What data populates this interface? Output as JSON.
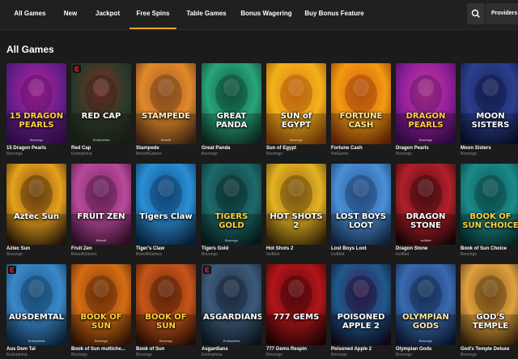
{
  "nav": {
    "tabs": [
      {
        "label": "All Games"
      },
      {
        "label": "New"
      },
      {
        "label": "Jackpot"
      },
      {
        "label": "Free Spins",
        "active": true
      },
      {
        "label": "Table Games"
      },
      {
        "label": "Bonus Wagering"
      },
      {
        "label": "Buy Bonus Feature"
      }
    ],
    "providers_label": "Providers",
    "search_icon": "search-icon",
    "accent_color": "#f5a31a"
  },
  "section_title": "All Games",
  "games": [
    {
      "name": "15 Dragon Pearls",
      "provider": "Booongo",
      "art_title": "15 DRAGON PEARLS",
      "art_provider": "Booongo",
      "colors": [
        "#6a1f8c",
        "#c4209a",
        "#3b0f5a"
      ],
      "title_color": "#ffd23a",
      "badge": false
    },
    {
      "name": "Red Cap",
      "provider": "Endorphina",
      "art_title": "RED CAP",
      "art_provider": "Endorphina",
      "colors": [
        "#2e3b2a",
        "#8c2b22",
        "#1d2618"
      ],
      "title_color": "#ffffff",
      "badge": true
    },
    {
      "name": "Stampede",
      "provider": "BetsoftGames",
      "art_title": "STAMPEDE",
      "art_provider": "Betsoft",
      "colors": [
        "#e08a2c",
        "#a85a1e",
        "#4a2a14"
      ],
      "title_color": "#fff1c2",
      "badge": false
    },
    {
      "name": "Great Panda",
      "provider": "Booongo",
      "art_title": "GREAT PANDA",
      "art_provider": "",
      "colors": [
        "#2aa57a",
        "#0e5a44",
        "#0b2f25"
      ],
      "title_color": "#ffffff",
      "badge": false
    },
    {
      "name": "Sun of Egypt",
      "provider": "Booongo",
      "art_title": "SUN of EGYPT",
      "art_provider": "Booongo",
      "colors": [
        "#f2b21c",
        "#e07b11",
        "#8a3d07"
      ],
      "title_color": "#ffffff",
      "badge": false
    },
    {
      "name": "Fortune Cash",
      "provider": "NetGame",
      "art_title": "FORTUNE CASH",
      "art_provider": "",
      "colors": [
        "#f39a12",
        "#d4600e",
        "#7a2b06"
      ],
      "title_color": "#ffe7a0",
      "badge": false
    },
    {
      "name": "Dragon Pearls",
      "provider": "Booongo",
      "art_title": "DRAGON PEARLS",
      "art_provider": "Booongo",
      "colors": [
        "#8e1f9a",
        "#d13a9c",
        "#3a0c4f"
      ],
      "title_color": "#ffd23a",
      "badge": false
    },
    {
      "name": "Moon Sisters",
      "provider": "Booongo",
      "art_title": "MOON SISTERS",
      "art_provider": "",
      "colors": [
        "#2b3f8c",
        "#1a2460",
        "#0a0f30"
      ],
      "title_color": "#ffffff",
      "badge": false
    },
    {
      "name": "Aztec Sun",
      "provider": "Booongo",
      "art_title": "Aztec Sun",
      "art_provider": "",
      "colors": [
        "#e6a11e",
        "#8a4f0c",
        "#2a1b0a"
      ],
      "title_color": "#ffffff",
      "badge": false
    },
    {
      "name": "Fruit Zen",
      "provider": "BetsoftGames",
      "art_title": "FRUIT ZEN",
      "art_provider": "Betsoft",
      "colors": [
        "#b84a9a",
        "#7a2a6a",
        "#3a1030"
      ],
      "title_color": "#ffffff",
      "badge": false
    },
    {
      "name": "Tiger's Claw",
      "provider": "BetsoftGames",
      "art_title": "Tigers Claw",
      "art_provider": "",
      "colors": [
        "#2b8fd4",
        "#12508c",
        "#0a2748"
      ],
      "title_color": "#ffffff",
      "badge": false
    },
    {
      "name": "Tigers Gold",
      "provider": "Booongo",
      "art_title": "TIGERS GOLD",
      "art_provider": "Booongo",
      "colors": [
        "#1f6a6a",
        "#0f3d3d",
        "#072020"
      ],
      "title_color": "#ffd23a",
      "badge": false
    },
    {
      "name": "Hot Shots 2",
      "provider": "Isoftbet",
      "art_title": "HOT SHOTS 2",
      "art_provider": "",
      "colors": [
        "#e3b325",
        "#9a6a10",
        "#3e2a06"
      ],
      "title_color": "#ffffff",
      "badge": false
    },
    {
      "name": "Lost Boys Loot",
      "provider": "Isoftbet",
      "art_title": "LOST BOYS LOOT",
      "art_provider": "",
      "colors": [
        "#4a8fd6",
        "#2a5a9a",
        "#142c4e"
      ],
      "title_color": "#ffffff",
      "badge": false
    },
    {
      "name": "Dragon Stone",
      "provider": "Isoftbet",
      "art_title": "DRAGON STONE",
      "art_provider": "Isoftbet",
      "colors": [
        "#b0202a",
        "#5e0e16",
        "#1e0508"
      ],
      "title_color": "#ffffff",
      "badge": false
    },
    {
      "name": "Book of Sun Choice",
      "provider": "Booongo",
      "art_title": "BOOK OF SUN CHOICE",
      "art_provider": "",
      "colors": [
        "#1c8a8a",
        "#0d5a5a",
        "#05302f"
      ],
      "title_color": "#ffd23a",
      "badge": false
    },
    {
      "name": "Aus Dem Tal",
      "provider": "Endorphina",
      "art_title": "AUSDEMTAL",
      "art_provider": "Endorphina",
      "colors": [
        "#3a88c9",
        "#1f5a8c",
        "#0c2a44"
      ],
      "title_color": "#ffffff",
      "badge": true
    },
    {
      "name": "Book of Sun multiche...",
      "provider": "Booongo",
      "art_title": "BOOK OF SUN",
      "art_provider": "Booongo",
      "colors": [
        "#d46e15",
        "#8a3a07",
        "#3a1604"
      ],
      "title_color": "#ffd23a",
      "badge": false
    },
    {
      "name": "Book of Sun",
      "provider": "Booongo",
      "art_title": "BOOK OF SUN",
      "art_provider": "Booongo",
      "colors": [
        "#c5551a",
        "#7a2c0a",
        "#2e1004"
      ],
      "title_color": "#ffd23a",
      "badge": false
    },
    {
      "name": "Asgardians",
      "provider": "Endorphina",
      "art_title": "ASGARDIANS",
      "art_provider": "Endorphina",
      "colors": [
        "#3c5a7a",
        "#22364c",
        "#0e1824"
      ],
      "title_color": "#ffffff",
      "badge": true
    },
    {
      "name": "777 Gems Respin",
      "provider": "Booongo",
      "art_title": "777 GEMS",
      "art_provider": "",
      "colors": [
        "#b0151a",
        "#6a080c",
        "#240304"
      ],
      "title_color": "#ffffff",
      "badge": false
    },
    {
      "name": "Poisoned Apple 2",
      "provider": "Booongo",
      "art_title": "POISONED APPLE 2",
      "art_provider": "",
      "colors": [
        "#1e5a8c",
        "#3a1a5a",
        "#12081e"
      ],
      "title_color": "#ffffff",
      "badge": false
    },
    {
      "name": "Olympian Gods",
      "provider": "Booongo",
      "art_title": "OLYMPIAN GODS",
      "art_provider": "Booongo",
      "colors": [
        "#3a6ab0",
        "#1a3a6a",
        "#0a1a34"
      ],
      "title_color": "#ffe7a0",
      "badge": false
    },
    {
      "name": "God's Temple Deluxe",
      "provider": "Booongo",
      "art_title": "GOD'S TEMPLE",
      "art_provider": "",
      "colors": [
        "#e0a040",
        "#8a5a18",
        "#3a2408"
      ],
      "title_color": "#ffffff",
      "badge": false
    }
  ]
}
